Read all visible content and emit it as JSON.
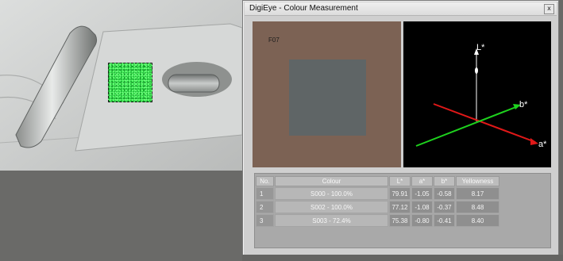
{
  "window": {
    "title": "DigiEye - Colour Measurement",
    "close_label": "x"
  },
  "swatch": {
    "code": "F07",
    "outer_color": "#7c6254",
    "inner_color": "#5f6566"
  },
  "lab_plot": {
    "axis_l_label": "L*",
    "axis_a_label": "a*",
    "axis_b_label": "b*",
    "colors": {
      "l": "#ffffff",
      "a": "#e01818",
      "b": "#1ed21e"
    }
  },
  "table": {
    "headers": [
      "No.",
      "Colour",
      "L*",
      "a*",
      "b*",
      "Yellowness"
    ],
    "rows": [
      {
        "no": "1",
        "colour": "S000 - 100.0%",
        "l": "79.91",
        "a": "-1.05",
        "b": "-0.58",
        "yellowness": "8.17"
      },
      {
        "no": "2",
        "colour": "S002 - 100.0%",
        "l": "77.12",
        "a": "-1.08",
        "b": "-0.37",
        "yellowness": "8.48"
      },
      {
        "no": "3",
        "colour": "S003 - 72.4%",
        "l": "75.38",
        "a": "-0.80",
        "b": "-0.41",
        "yellowness": "8.40"
      }
    ]
  },
  "photo": {
    "subject": "car door interior with handle",
    "selection_color": "#22c23a"
  }
}
